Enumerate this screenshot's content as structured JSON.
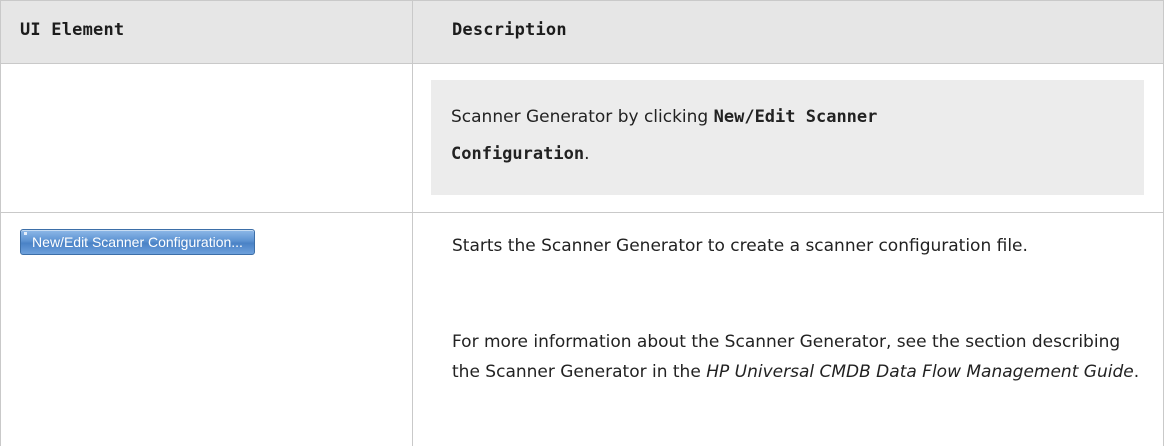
{
  "table": {
    "header": {
      "col1": "UI Element",
      "col2": "Description"
    },
    "note": {
      "text_prefix": "Scanner Generator by clicking ",
      "bold": "New/Edit Scanner Configuration",
      "suffix": "."
    },
    "row": {
      "button_label": "New/Edit Scanner Configuration...",
      "description_1": "Starts the Scanner Generator to create a scanner configuration file.",
      "description_2_prefix": "For more information about the Scanner Generator, see the section describing the Scanner Generator in the ",
      "description_2_italic": "HP Universal CMDB Data Flow Management Guide",
      "description_2_suffix": "."
    }
  }
}
